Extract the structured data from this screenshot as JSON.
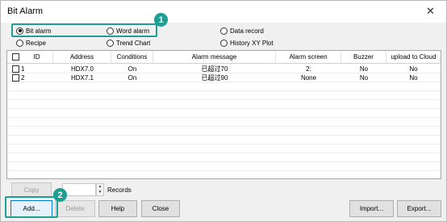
{
  "window": {
    "title": "Bit Alarm",
    "close_glyph": "✕"
  },
  "types": {
    "bit_alarm": "Bit alarm",
    "word_alarm": "Word alarm",
    "data_record": "Data record",
    "recipe": "Recipe",
    "trend_chart": "Trend Chart",
    "history_xy_plot": "History XY Plot",
    "selected": "Bit alarm"
  },
  "callouts": {
    "first": "1",
    "second": "2"
  },
  "table": {
    "columns": [
      "ID",
      "Address",
      "Conditions",
      "Alarm message",
      "Alarm screen",
      "Buzzer",
      "upload to Cloud"
    ],
    "rows": [
      {
        "id": "1",
        "address": "HDX7.0",
        "conditions": "On",
        "message": "已超过70",
        "screen": "2:",
        "buzzer": "No",
        "cloud": "No"
      },
      {
        "id": "2",
        "address": "HDX7.1",
        "conditions": "On",
        "message": "已超过90",
        "screen": "None",
        "buzzer": "No",
        "cloud": "No"
      }
    ]
  },
  "toolbar": {
    "copy": "Copy",
    "records": "Records",
    "add": "Add...",
    "delete": "Delete",
    "help": "Help",
    "close": "Close",
    "import": "Import...",
    "export": "Export..."
  },
  "colors": {
    "accent": "#1f9e91"
  }
}
